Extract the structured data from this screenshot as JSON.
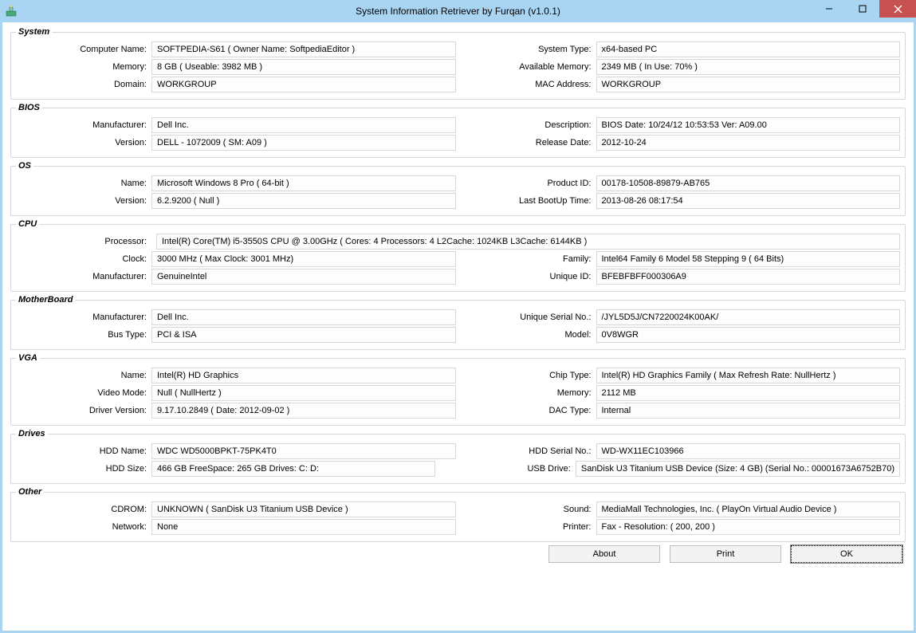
{
  "window": {
    "title": "System Information Retriever by Furqan (v1.0.1)"
  },
  "buttons": {
    "about": "About",
    "print": "Print",
    "ok": "OK"
  },
  "labels": {
    "system": "System",
    "computer_name": "Computer Name:",
    "memory": "Memory:",
    "domain": "Domain:",
    "system_type": "System Type:",
    "available_memory": "Available Memory:",
    "mac_address": "MAC Address:",
    "bios": "BIOS",
    "manufacturer": "Manufacturer:",
    "version": "Version:",
    "description": "Description:",
    "release_date": "Release Date:",
    "os": "OS",
    "name": "Name:",
    "product_id": "Product ID:",
    "last_bootup": "Last BootUp Time:",
    "cpu": "CPU",
    "processor": "Processor:",
    "clock": "Clock:",
    "family": "Family:",
    "unique_id": "Unique ID:",
    "motherboard": "MotherBoard",
    "bus_type": "Bus Type:",
    "unique_serial": "Unique Serial No.:",
    "model": "Model:",
    "vga": "VGA",
    "video_mode": "Video Mode:",
    "driver_version": "Driver Version:",
    "chip_type": "Chip Type:",
    "dac_type": "DAC Type:",
    "drives": "Drives",
    "hdd_name": "HDD Name:",
    "hdd_size": "HDD Size:",
    "hdd_serial": "HDD Serial No.:",
    "usb_drive": "USB Drive:",
    "other": "Other",
    "cdrom": "CDROM:",
    "network": "Network:",
    "sound": "Sound:",
    "printer": "Printer:"
  },
  "system": {
    "computer_name": "SOFTPEDIA-S61  ( Owner Name: SoftpediaEditor )",
    "memory": "8 GB   ( Useable: 3982 MB )",
    "domain": "WORKGROUP",
    "system_type": "x64-based PC",
    "available_memory": "2349 MB   ( In Use: 70% )",
    "mac_address": "WORKGROUP"
  },
  "bios": {
    "manufacturer": "Dell Inc.",
    "version": "DELL   - 1072009 ( SM: A09 )",
    "description": "BIOS Date: 10/24/12 10:53:53 Ver: A09.00",
    "release_date": "2012-10-24"
  },
  "os": {
    "name": "Microsoft Windows 8 Pro ( 64-bit )",
    "version": "6.2.9200 ( Null )",
    "product_id": "00178-10508-89879-AB765",
    "last_bootup": "2013-08-26 08:17:54"
  },
  "cpu": {
    "processor": "Intel(R) Core(TM) i5-3550S CPU @ 3.00GHz  ( Cores: 4  Processors: 4  L2Cache: 1024KB  L3Cache: 6144KB )",
    "clock": "3000 MHz   ( Max Clock: 3001 MHz)",
    "manufacturer": "GenuineIntel",
    "family": "Intel64 Family 6 Model 58 Stepping 9 ( 64 Bits)",
    "unique_id": "BFEBFBFF000306A9"
  },
  "motherboard": {
    "manufacturer": "Dell Inc.",
    "bus_type": "PCI  &   ISA",
    "unique_serial": "/JYL5D5J/CN7220024K00AK/",
    "model": "0V8WGR"
  },
  "vga": {
    "name": "Intel(R) HD Graphics",
    "video_mode": "Null ( NullHertz )",
    "driver_version": "9.17.10.2849 ( Date: 2012-09-02 )",
    "chip_type": "Intel(R) HD Graphics Family  ( Max Refresh Rate: NullHertz )",
    "memory": "2112 MB",
    "dac_type": "Internal"
  },
  "drives": {
    "hdd_name": "WDC WD5000BPKT-75PK4T0",
    "hdd_size": "466 GB   FreeSpace: 265 GB  Drives:  C: D:",
    "hdd_serial": "     WD-WX11EC103966",
    "usb_drive": "SanDisk U3 Titanium USB Device (Size: 4 GB) (Serial No.: 00001673A6752B70)"
  },
  "other": {
    "cdrom": "UNKNOWN ( SanDisk U3 Titanium USB Device )",
    "network": "None",
    "sound": "MediaMall Technologies, Inc. ( PlayOn Virtual Audio Device )",
    "printer": "Fax - Resolution: ( 200, 200 )"
  }
}
